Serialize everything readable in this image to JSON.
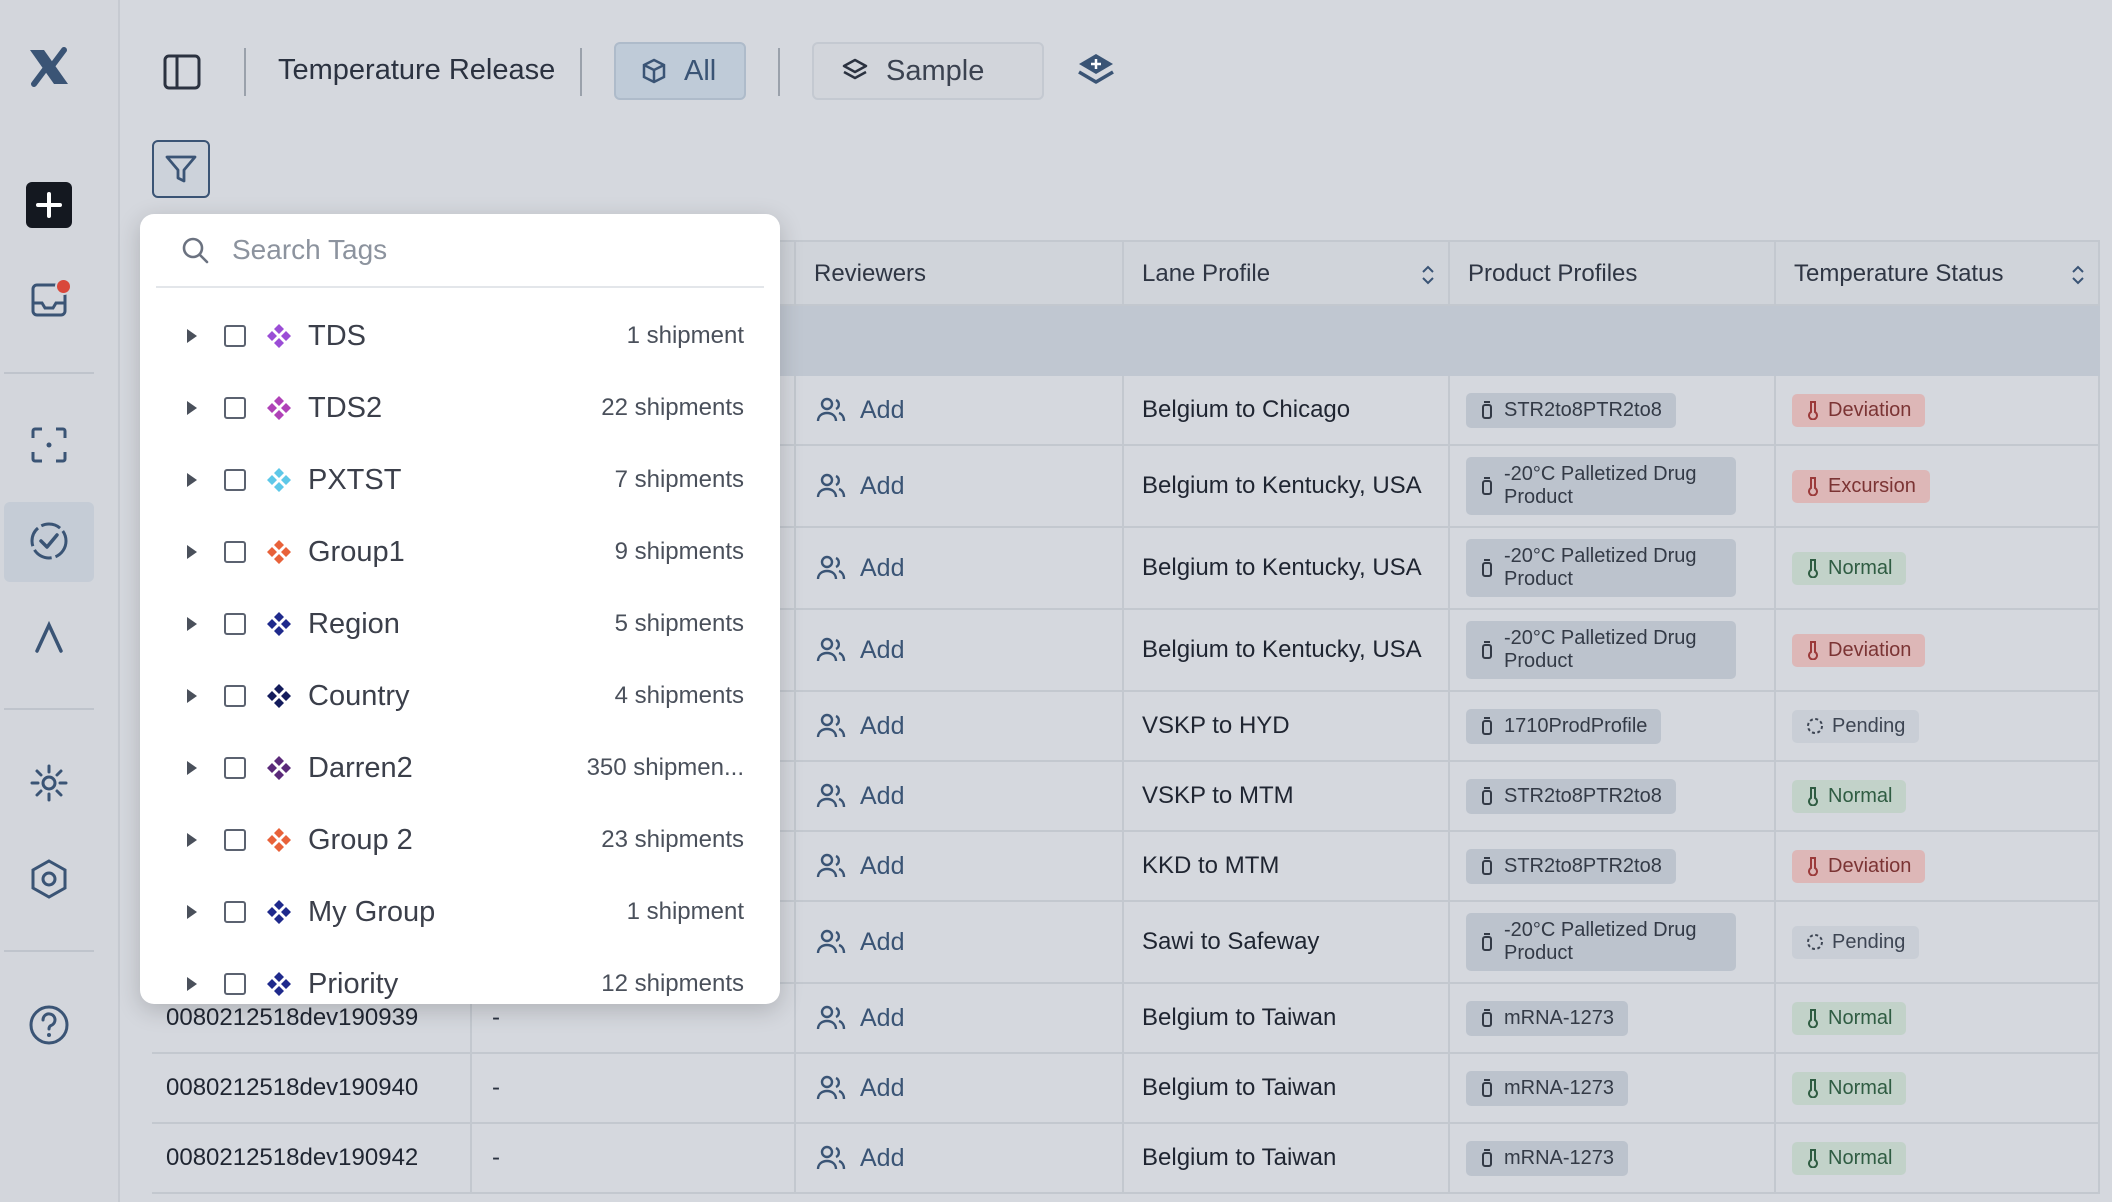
{
  "header": {
    "title": "Temperature Release",
    "all_label": "All",
    "sample_label": "Sample"
  },
  "tag_search": {
    "placeholder": "Search Tags",
    "tags": [
      {
        "name": "TDS",
        "count": "1 shipment",
        "color": "#9b4dd6"
      },
      {
        "name": "TDS2",
        "count": "22 shipments",
        "color": "#b042b8"
      },
      {
        "name": "PXTST",
        "count": "7 shipments",
        "color": "#5ec8e8"
      },
      {
        "name": "Group1",
        "count": "9 shipments",
        "color": "#e8623a"
      },
      {
        "name": "Region",
        "count": "5 shipments",
        "color": "#1f2a8c"
      },
      {
        "name": "Country",
        "count": "4 shipments",
        "color": "#141c5c"
      },
      {
        "name": "Darren2",
        "count": "350 shipmen...",
        "color": "#5b2a7a"
      },
      {
        "name": "Group 2",
        "count": "23 shipments",
        "color": "#e8623a"
      },
      {
        "name": "My Group",
        "count": "1 shipment",
        "color": "#1f2a8c"
      },
      {
        "name": "Priority",
        "count": "12 shipments",
        "color": "#1f2a8c"
      }
    ]
  },
  "table": {
    "columns": {
      "reviewers": "Reviewers",
      "lane_profile": "Lane Profile",
      "product_profiles": "Product Profiles",
      "temperature_status": "Temperature Status"
    },
    "add_label": "Add",
    "rows": [
      {
        "id": "",
        "dash": "",
        "lane": "Belgium to Chicago",
        "product": "STR2to8PTR2to8",
        "status": "Deviation",
        "kind": "dev"
      },
      {
        "id": "",
        "dash": "",
        "lane": "Belgium to Kentucky, USA",
        "product": "-20°C Palletized Drug Product",
        "status": "Excursion",
        "kind": "dev"
      },
      {
        "id": "",
        "dash": "",
        "lane": "Belgium to Kentucky, USA",
        "product": "-20°C Palletized Drug Product",
        "status": "Normal",
        "kind": "norm"
      },
      {
        "id": "",
        "dash": "",
        "lane": "Belgium to Kentucky, USA",
        "product": "-20°C Palletized Drug Product",
        "status": "Deviation",
        "kind": "dev"
      },
      {
        "id": "",
        "dash": "",
        "lane": "VSKP to HYD",
        "product": "1710ProdProfile",
        "status": "Pending",
        "kind": "pend"
      },
      {
        "id": "",
        "dash": "",
        "lane": "VSKP to MTM",
        "product": "STR2to8PTR2to8",
        "status": "Normal",
        "kind": "norm"
      },
      {
        "id": "",
        "dash": "",
        "lane": "KKD to MTM",
        "product": "STR2to8PTR2to8",
        "status": "Deviation",
        "kind": "dev"
      },
      {
        "id": "",
        "dash": "",
        "lane": "Sawi to Safeway",
        "product": "-20°C Palletized Drug Product",
        "status": "Pending",
        "kind": "pend"
      },
      {
        "id": "0080212518dev190939",
        "dash": "-",
        "lane": "Belgium to Taiwan",
        "product": "mRNA-1273",
        "status": "Normal",
        "kind": "norm"
      },
      {
        "id": "0080212518dev190940",
        "dash": "-",
        "lane": "Belgium to Taiwan",
        "product": "mRNA-1273",
        "status": "Normal",
        "kind": "norm"
      },
      {
        "id": "0080212518dev190942",
        "dash": "-",
        "lane": "Belgium to Taiwan",
        "product": "mRNA-1273",
        "status": "Normal",
        "kind": "norm"
      }
    ]
  }
}
